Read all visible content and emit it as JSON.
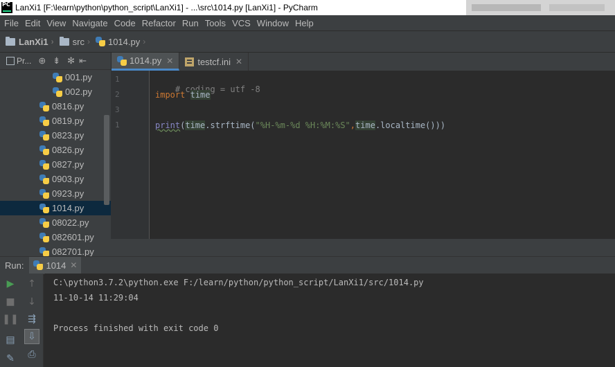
{
  "window": {
    "app_icon_text": "PC",
    "title": "LanXi1 [F:\\learn\\python\\python_script\\LanXi1] - ...\\src\\1014.py [LanXi1] - PyCharm"
  },
  "menu": [
    "File",
    "Edit",
    "View",
    "Navigate",
    "Code",
    "Refactor",
    "Run",
    "Tools",
    "VCS",
    "Window",
    "Help"
  ],
  "breadcrumb": {
    "project": "LanXi1",
    "folder": "src",
    "file": "1014.py"
  },
  "project_panel": {
    "tab_label": "Pr...",
    "files": [
      {
        "name": "001.py",
        "level": 2
      },
      {
        "name": "002.py",
        "level": 2
      },
      {
        "name": "0816.py",
        "level": 1
      },
      {
        "name": "0819.py",
        "level": 1
      },
      {
        "name": "0823.py",
        "level": 1
      },
      {
        "name": "0826.py",
        "level": 1
      },
      {
        "name": "0827.py",
        "level": 1
      },
      {
        "name": "0903.py",
        "level": 1
      },
      {
        "name": "0923.py",
        "level": 1
      },
      {
        "name": "1014.py",
        "level": 1,
        "selected": true
      },
      {
        "name": "08022.py",
        "level": 1
      },
      {
        "name": "082601.py",
        "level": 1
      },
      {
        "name": "082701.py",
        "level": 1
      }
    ]
  },
  "editor_tabs": [
    {
      "label": "1014.py",
      "icon": "python-file-icon",
      "active": true
    },
    {
      "label": "testcf.ini",
      "icon": "ini-file-icon",
      "active": false
    }
  ],
  "editor": {
    "line_numbers": [
      "1",
      "2",
      "3",
      "1"
    ],
    "line1_comment": "# coding = utf -8",
    "line2_keyword": "import",
    "line2_module": "time",
    "line4_print": "print",
    "line4_part1": "(",
    "line4_time": "time",
    "line4_part2": ".strftime(",
    "line4_string": "\"%H-%m-%d %H:%M:%S\"",
    "line4_comma": ",",
    "line4_time2": "time",
    "line4_part3": ".localtime()))"
  },
  "run_panel": {
    "label": "Run:",
    "tab": "1014",
    "console": [
      "C:\\python3.7.2\\python.exe F:/learn/python/python_script/LanXi1/src/1014.py",
      "11-10-14 11:29:04",
      "",
      "Process finished with exit code 0"
    ]
  },
  "colors": {
    "background": "#2b2b2b",
    "panel": "#3c3f41",
    "selection": "#0d293e",
    "keyword": "#cc7832",
    "string": "#6a8759",
    "run_green": "#499c54"
  }
}
